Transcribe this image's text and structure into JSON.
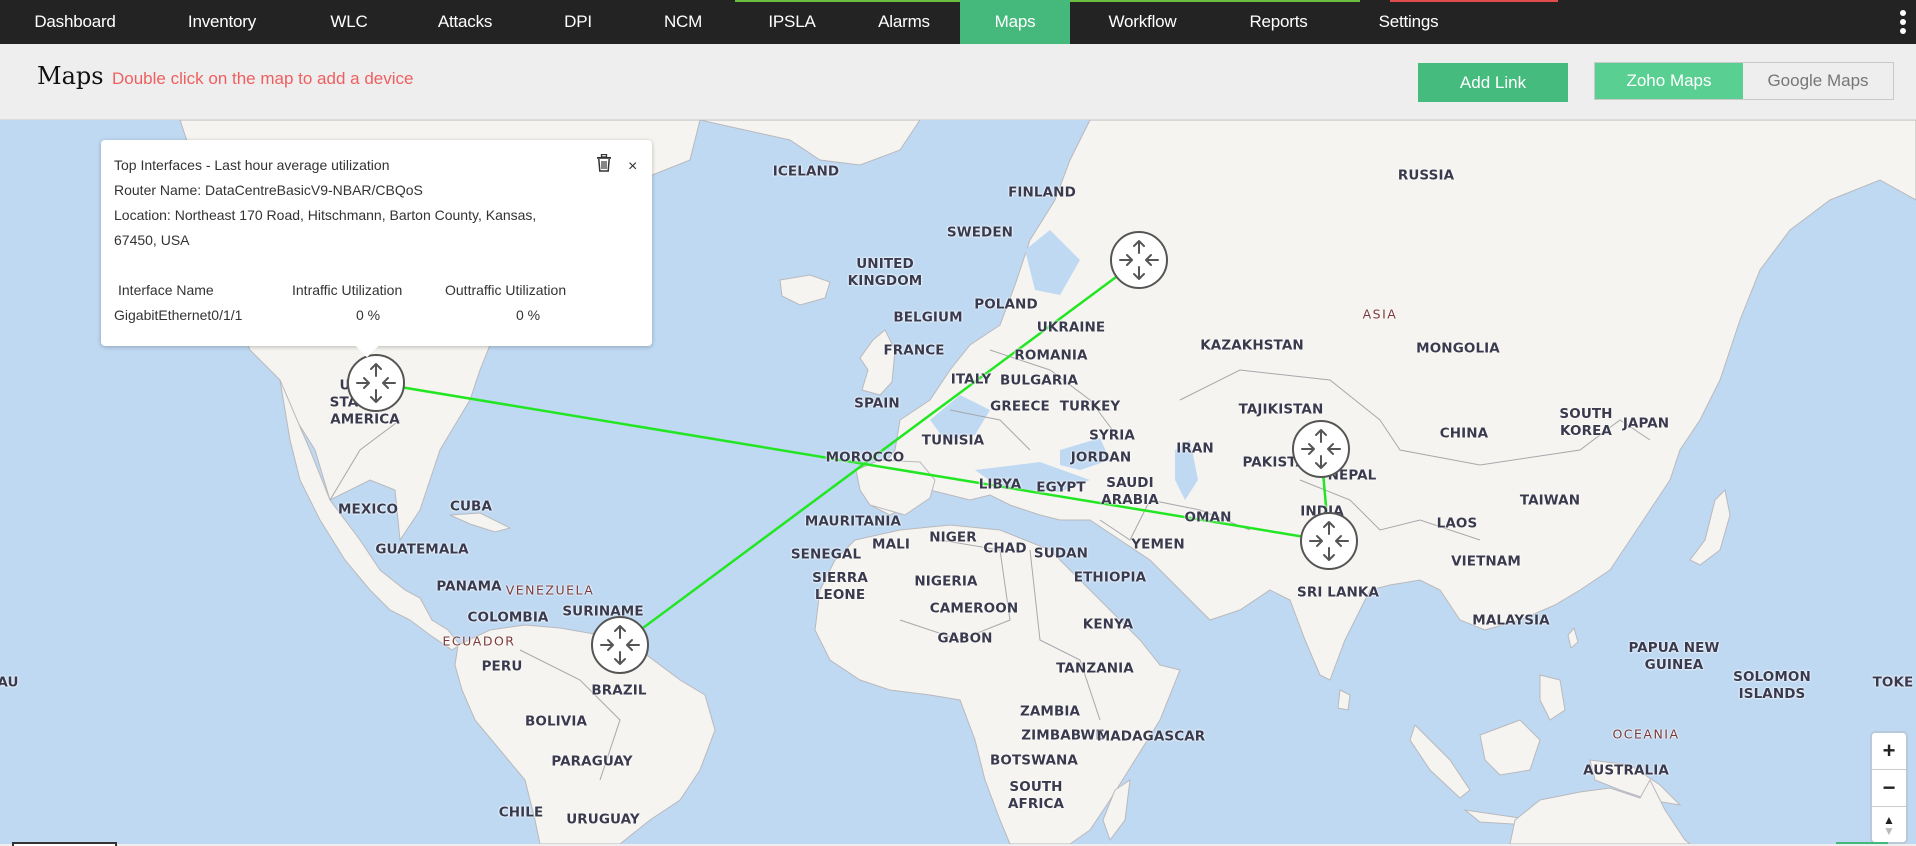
{
  "nav": {
    "items": [
      "Dashboard",
      "Inventory",
      "WLC",
      "Attacks",
      "DPI",
      "NCM",
      "IPSLA",
      "Alarms",
      "Maps",
      "Workflow",
      "Reports",
      "Settings"
    ],
    "active": "Maps",
    "more_icon": "kebab-vertical-icon"
  },
  "header": {
    "title": "Maps",
    "hint": "Double click on the map to add a device",
    "add_link_label": "Add Link",
    "map_providers": [
      "Zoho Maps",
      "Google Maps"
    ],
    "selected_provider": "Zoho Maps"
  },
  "popup": {
    "title": "Top Interfaces - Last hour average utilization",
    "router_name": "Router Name: DataCentreBasicV9-NBAR/CBQoS",
    "location_line1": "Location: Northeast 170 Road, Hitschmann, Barton County, Kansas,",
    "location_line2": "67450, USA",
    "columns": [
      "Interface Name",
      "Intraffic Utilization",
      "Outtraffic Utilization"
    ],
    "rows": [
      {
        "interface": "GigabitEthernet0/1/1",
        "in": "0 %",
        "out": "0 %"
      }
    ],
    "delete_icon": "trash-icon",
    "close_label": "×"
  },
  "map": {
    "link_color": "#22e622",
    "routers": [
      {
        "name": "router-usa"
      },
      {
        "name": "router-russia"
      },
      {
        "name": "router-pakistan"
      },
      {
        "name": "router-india"
      },
      {
        "name": "router-brazil"
      }
    ],
    "links": [
      {
        "from": "router-usa",
        "to": "router-india"
      },
      {
        "from": "router-russia",
        "to": "router-brazil"
      },
      {
        "from": "router-pakistan",
        "to": "router-india"
      }
    ],
    "labels": {
      "iceland": "ICELAND",
      "finland": "FINLAND",
      "sweden": "SWEDEN",
      "russia": "RUSSIA",
      "uk1": "UNITED",
      "uk2": "KINGDOM",
      "poland": "POLAND",
      "belgium": "BELGIUM",
      "ukraine": "UKRAINE",
      "france": "FRANCE",
      "romania": "ROMANIA",
      "italy": "ITALY",
      "bulgaria": "BULGARIA",
      "spain": "SPAIN",
      "greece": "GREECE",
      "turkey": "TURKEY",
      "tunisia": "TUNISIA",
      "syria": "SYRIA",
      "asia": "ASIA",
      "kazakhstan": "KAZAKHSTAN",
      "mongolia": "MONGOLIA",
      "tajikistan": "TAJIKISTAN",
      "china": "CHINA",
      "southkorea1": "SOUTH",
      "southkorea2": "KOREA",
      "japan": "JAPAN",
      "iran": "IRAN",
      "pakistan": "PAKISTAN",
      "nepal": "NEPAL",
      "india": "INDIA",
      "jordan": "JORDAN",
      "saudi1": "SAUDI",
      "saudi2": "ARABIA",
      "morocco": "MOROCCO",
      "libya": "LIBYA",
      "egypt": "EGYPT",
      "oman": "OMAN",
      "yemen": "YEMEN",
      "taiwan": "TAIWAN",
      "laos": "LAOS",
      "vietnam": "VIETNAM",
      "srilanka": "SRI LANKA",
      "mauritania": "MAURITANIA",
      "mali": "MALI",
      "niger": "NIGER",
      "chad": "CHAD",
      "sudan": "SUDAN",
      "senegal": "SENEGAL",
      "sierra1": "SIERRA",
      "sierra2": "LEONE",
      "nigeria": "NIGERIA",
      "ethiopia": "ETHIOPIA",
      "cameroon": "CAMEROON",
      "kenya": "KENYA",
      "gabon": "GABON",
      "tanzania": "TANZANIA",
      "zambia": "ZAMBIA",
      "zimbabwe": "ZIMBABWE",
      "madagascar": "MADAGASCAR",
      "botswana": "BOTSWANA",
      "southafrica1": "SOUTH",
      "southafrica2": "AFRICA",
      "malaysia": "MALAYSIA",
      "png1": "PAPUA NEW",
      "png2": "GUINEA",
      "solomon1": "SOLOMON",
      "solomon2": "ISLANDS",
      "toke": "TOKE",
      "oceania": "OCEANIA",
      "australia": "AUSTRALIA",
      "usa1": "U",
      "usa2": "STA",
      "usa3": "AMERICA",
      "mexico": "MEXICO",
      "cuba": "CUBA",
      "guatemala": "GUATEMALA",
      "panama": "PANAMA",
      "venezuela": "VENEZUELA",
      "colombia": "COLOMBIA",
      "suriname": "SURINAME",
      "ecuador": "ECUADOR",
      "peru": "PERU",
      "brazil": "BRAZIL",
      "bolivia": "BOLIVIA",
      "paraguay": "PARAGUAY",
      "chile": "CHILE",
      "uruguay": "URUGUAY",
      "au": "AU"
    },
    "zoom_in_label": "+",
    "zoom_out_label": "−"
  }
}
